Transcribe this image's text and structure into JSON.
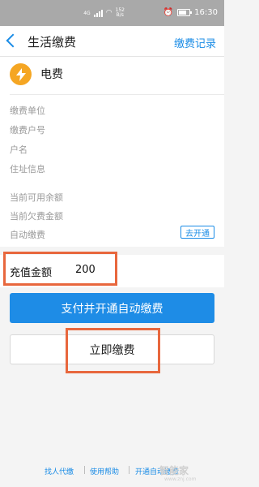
{
  "status_bar": {
    "signal_label": "4G",
    "speed_value": "152",
    "speed_unit": "B/s",
    "time": "16:30"
  },
  "nav": {
    "title": "生活缴费",
    "right_link": "缴费记录"
  },
  "bill": {
    "title": "电费",
    "icon": "lightning-icon",
    "icon_color": "#f5a623"
  },
  "fields": [
    "缴费单位",
    "缴费户号",
    "户名",
    "住址信息",
    "当前可用余额",
    "当前欠费金额",
    "自动缴费"
  ],
  "auto_pay_button": "去开通",
  "amount": {
    "label": "充值金额",
    "value": "200"
  },
  "buttons": {
    "primary": "支付并开通自动缴费",
    "secondary": "立即缴费"
  },
  "footer": {
    "links": [
      "找人代缴",
      "使用帮助",
      "开通自动缴费"
    ]
  },
  "watermark": {
    "main": "智能家",
    "sub": "www.znj.com"
  },
  "colors": {
    "accent": "#1a8ce6",
    "highlight": "#e8673d"
  }
}
